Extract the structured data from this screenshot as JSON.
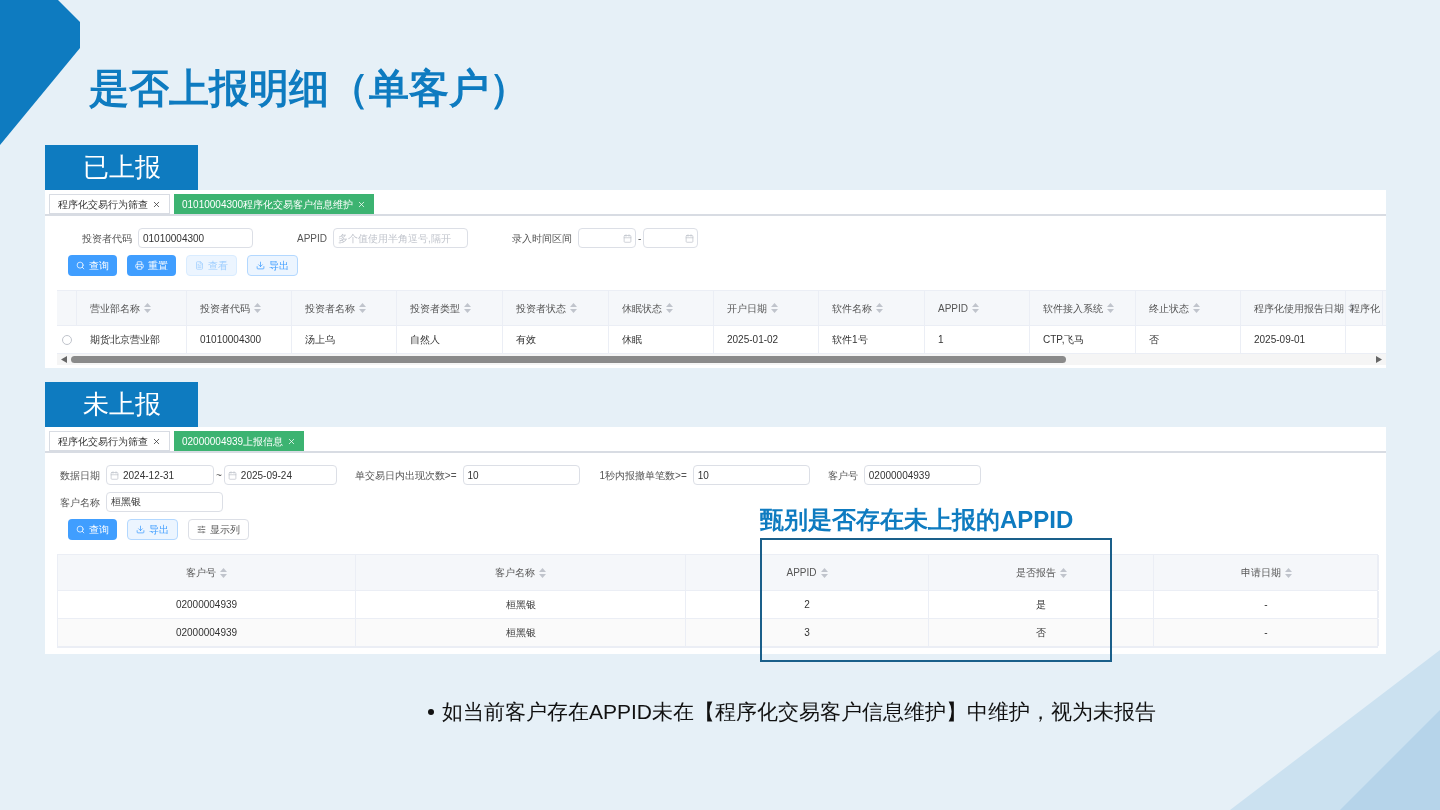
{
  "slide": {
    "title": "是否上报明细（单客户）"
  },
  "reported": {
    "label": "已上报",
    "tabs": [
      {
        "label": "程序化交易行为筛查",
        "selected": false
      },
      {
        "label": "01010004300程序化交易客户信息维护",
        "selected": true
      }
    ],
    "filters": [
      {
        "kind": "text",
        "label": "投资者代码",
        "value": "01010004300"
      },
      {
        "kind": "text",
        "label": "APPID",
        "placeholder": "多个值使用半角逗号,隔开"
      },
      {
        "kind": "daterange",
        "label": "录入时间区间",
        "separator": "-"
      }
    ],
    "buttons": [
      {
        "label": "查询",
        "kind": "primary"
      },
      {
        "label": "重置",
        "kind": "primary"
      },
      {
        "label": "查看",
        "kind": "disabled"
      },
      {
        "label": "导出",
        "kind": "light"
      }
    ],
    "columns": [
      "营业部名称",
      "投资者代码",
      "投资者名称",
      "投资者类型",
      "投资者状态",
      "休眠状态",
      "开户日期",
      "软件名称",
      "APPID",
      "软件接入系统",
      "终止状态",
      "程序化使用报告日期",
      "程序化"
    ],
    "rows": [
      {
        "selected": false,
        "cells": [
          "期货北京营业部",
          "01010004300",
          "汤上乌",
          "自然人",
          "有效",
          "休眠",
          "2025-01-02",
          "软件1号",
          "1",
          "CTP,飞马",
          "否",
          "2025-09-01"
        ]
      }
    ]
  },
  "unreported": {
    "label": "未上报",
    "tabs": [
      {
        "label": "程序化交易行为筛查",
        "selected": false
      },
      {
        "label": "02000004939上报信息",
        "selected": true
      }
    ],
    "filters": [
      {
        "kind": "daterange",
        "label": "数据日期",
        "from": "2024-12-31",
        "separator": "~",
        "to": "2025-09-24"
      },
      {
        "kind": "text",
        "label": "单交易日内出现次数>=",
        "value": "10"
      },
      {
        "kind": "text",
        "label": "1秒内报撤单笔数>=",
        "value": "10"
      },
      {
        "kind": "text",
        "label": "客户号",
        "value": "02000004939"
      },
      {
        "kind": "text",
        "label": "客户名称",
        "value": "桓黑银"
      }
    ],
    "buttons": [
      {
        "label": "查询",
        "kind": "primary"
      },
      {
        "label": "导出",
        "kind": "light"
      },
      {
        "label": "显示列",
        "kind": "plain"
      }
    ],
    "columns": [
      "客户号",
      "客户名称",
      "APPID",
      "是否报告",
      "申请日期"
    ],
    "rows": [
      {
        "cells": [
          "02000004939",
          "桓黑银",
          "2",
          "是",
          "-"
        ]
      },
      {
        "cells": [
          "02000004939",
          "桓黑银",
          "3",
          "否",
          "-"
        ]
      }
    ],
    "callout": "甄别是否存在未上报的APPID"
  },
  "bullets": [
    "如当前客户存在APPID未在【程序化交易客户信息维护】中维护，视为未报告"
  ]
}
